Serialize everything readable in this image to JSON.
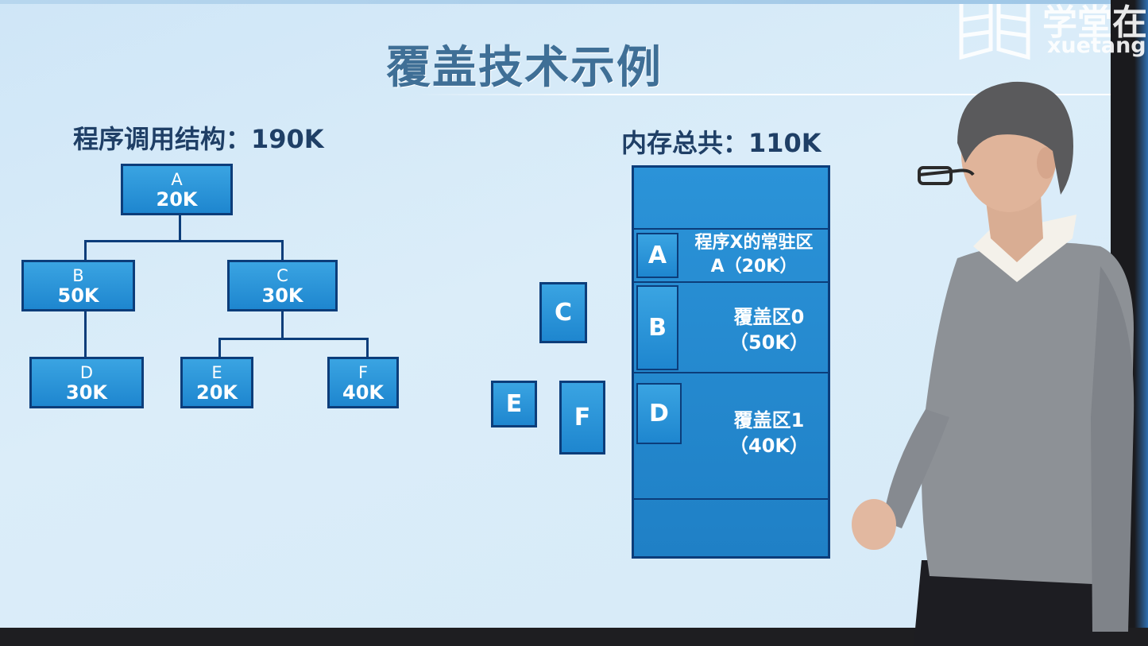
{
  "slide": {
    "title": "覆盖技术示例",
    "left_heading": "程序调用结构：190K",
    "right_heading": "内存总共：110K"
  },
  "tree": {
    "A": {
      "name": "A",
      "size": "20K"
    },
    "B": {
      "name": "B",
      "size": "50K"
    },
    "C": {
      "name": "C",
      "size": "30K"
    },
    "D": {
      "name": "D",
      "size": "30K"
    },
    "E": {
      "name": "E",
      "size": "20K"
    },
    "F": {
      "name": "F",
      "size": "40K"
    }
  },
  "loose_modules": {
    "C": "C",
    "E": "E",
    "F": "F"
  },
  "memory": {
    "resident": {
      "letter": "A",
      "line1": "程序X的常驻区",
      "line2": "A（20K）"
    },
    "overlay0": {
      "letter": "B",
      "line1": "覆盖区0",
      "line2": "（50K）"
    },
    "overlay1": {
      "letter": "D",
      "line1": "覆盖区1",
      "line2": "（40K）"
    }
  },
  "logo": {
    "cn": "学堂在",
    "en": "xuetang"
  },
  "colors": {
    "box_fill": "#1e86cf",
    "box_border": "#0c3d7a",
    "title": "#3f6f96"
  }
}
